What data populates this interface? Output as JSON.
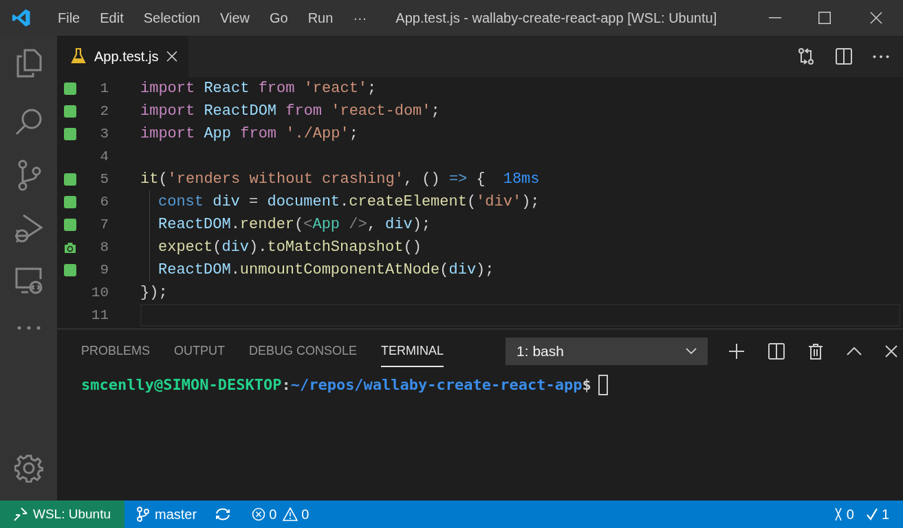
{
  "menu_bar": {
    "items": [
      "File",
      "Edit",
      "Selection",
      "View",
      "Go",
      "Run",
      "···"
    ],
    "title": "App.test.js - wallaby-create-react-app [WSL: Ubuntu]"
  },
  "editor_tab": {
    "label": "App.test.js",
    "selected": true
  },
  "code_lines": [
    {
      "number": "1",
      "covered": true,
      "snapshot": false,
      "indent": false,
      "current": false,
      "tokens": [
        {
          "text": "import ",
          "kind": "keyword"
        },
        {
          "text": "React ",
          "kind": "variable"
        },
        {
          "text": "from ",
          "kind": "keyword"
        },
        {
          "text": "'react'",
          "kind": "string"
        },
        {
          "text": ";",
          "kind": "plain"
        }
      ]
    },
    {
      "number": "2",
      "covered": true,
      "snapshot": false,
      "indent": false,
      "current": false,
      "tokens": [
        {
          "text": "import ",
          "kind": "keyword"
        },
        {
          "text": "ReactDOM ",
          "kind": "variable"
        },
        {
          "text": "from ",
          "kind": "keyword"
        },
        {
          "text": "'react-dom'",
          "kind": "string"
        },
        {
          "text": ";",
          "kind": "plain"
        }
      ]
    },
    {
      "number": "3",
      "covered": true,
      "snapshot": false,
      "indent": false,
      "current": false,
      "tokens": [
        {
          "text": "import ",
          "kind": "keyword"
        },
        {
          "text": "App ",
          "kind": "variable"
        },
        {
          "text": "from ",
          "kind": "keyword"
        },
        {
          "text": "'./App'",
          "kind": "string"
        },
        {
          "text": ";",
          "kind": "plain"
        }
      ]
    },
    {
      "number": "4",
      "covered": false,
      "snapshot": false,
      "indent": false,
      "current": false
    },
    {
      "number": "5",
      "covered": true,
      "snapshot": false,
      "indent": false,
      "current": false,
      "tokens": [
        {
          "text": "it",
          "kind": "function"
        },
        {
          "text": "(",
          "kind": "plain"
        },
        {
          "text": "'renders without crashing'",
          "kind": "string"
        },
        {
          "text": ", () ",
          "kind": "plain"
        },
        {
          "text": "=>",
          "kind": "storage"
        },
        {
          "text": " {",
          "kind": "plain"
        },
        {
          "text": "18ms",
          "kind": "hint"
        }
      ]
    },
    {
      "number": "6",
      "covered": true,
      "snapshot": false,
      "indent": true,
      "current": false,
      "tokens": [
        {
          "text": "const ",
          "kind": "storage"
        },
        {
          "text": "div",
          "kind": "variable"
        },
        {
          "text": " = ",
          "kind": "plain"
        },
        {
          "text": "document",
          "kind": "variable"
        },
        {
          "text": ".",
          "kind": "plain"
        },
        {
          "text": "createElement",
          "kind": "function"
        },
        {
          "text": "(",
          "kind": "plain"
        },
        {
          "text": "'div'",
          "kind": "string"
        },
        {
          "text": ");",
          "kind": "plain"
        }
      ]
    },
    {
      "number": "7",
      "covered": true,
      "snapshot": false,
      "indent": true,
      "current": false,
      "tokens": [
        {
          "text": "ReactDOM",
          "kind": "variable"
        },
        {
          "text": ".",
          "kind": "plain"
        },
        {
          "text": "render",
          "kind": "function"
        },
        {
          "text": "(",
          "kind": "plain"
        },
        {
          "text": "<",
          "kind": "tagpunct"
        },
        {
          "text": "App",
          "kind": "tag"
        },
        {
          "text": " />",
          "kind": "tagpunct"
        },
        {
          "text": ", ",
          "kind": "plain"
        },
        {
          "text": "div",
          "kind": "variable"
        },
        {
          "text": ");",
          "kind": "plain"
        }
      ]
    },
    {
      "number": "8",
      "covered": true,
      "snapshot": true,
      "indent": true,
      "current": false,
      "tokens": [
        {
          "text": "expect",
          "kind": "function"
        },
        {
          "text": "(",
          "kind": "plain"
        },
        {
          "text": "div",
          "kind": "variable"
        },
        {
          "text": ").",
          "kind": "plain"
        },
        {
          "text": "toMatchSnapshot",
          "kind": "function"
        },
        {
          "text": "()",
          "kind": "plain"
        }
      ]
    },
    {
      "number": "9",
      "covered": true,
      "snapshot": false,
      "indent": true,
      "current": false,
      "tokens": [
        {
          "text": "ReactDOM",
          "kind": "variable"
        },
        {
          "text": ".",
          "kind": "plain"
        },
        {
          "text": "unmountComponentAtNode",
          "kind": "function"
        },
        {
          "text": "(",
          "kind": "plain"
        },
        {
          "text": "div",
          "kind": "variable"
        },
        {
          "text": ");",
          "kind": "plain"
        }
      ]
    },
    {
      "number": "10",
      "covered": false,
      "snapshot": false,
      "indent": false,
      "current": false,
      "tokens": [
        {
          "text": "});",
          "kind": "plain"
        }
      ]
    },
    {
      "number": "11",
      "covered": false,
      "snapshot": false,
      "indent": false,
      "current": true
    }
  ],
  "panel": {
    "tabs": [
      {
        "label": "PROBLEMS",
        "selected": false
      },
      {
        "label": "OUTPUT",
        "selected": false
      },
      {
        "label": "DEBUG CONSOLE",
        "selected": false
      },
      {
        "label": "TERMINAL",
        "selected": true
      }
    ],
    "terminal_select": "1: bash",
    "prompt": {
      "user": "smcenlly@SIMON-DESKTOP",
      "separator": ":",
      "path": "~/repos/wallaby-create-react-app",
      "symbol": "$"
    }
  },
  "status_bar": {
    "remote": "WSL: Ubuntu",
    "branch": "master",
    "errors": "0",
    "warnings": "0",
    "failed": "0",
    "passed": "1"
  }
}
